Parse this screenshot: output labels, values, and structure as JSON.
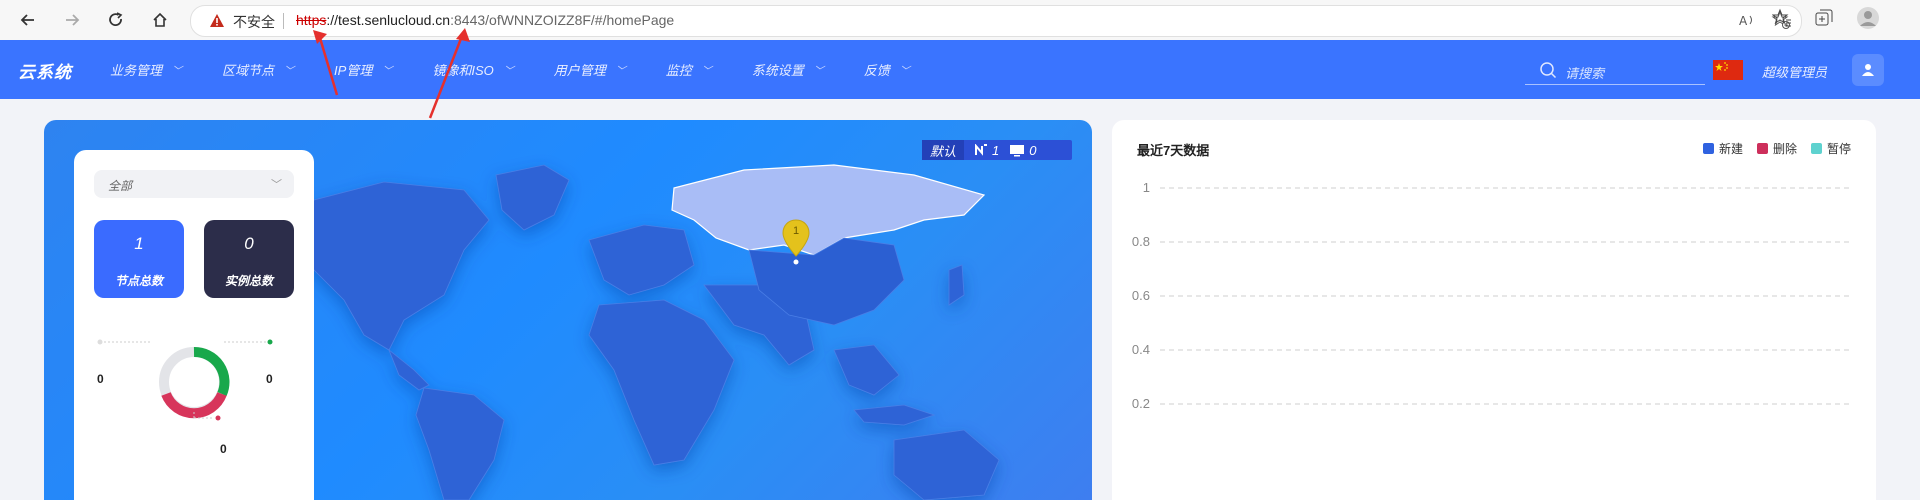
{
  "browser": {
    "insecure_label": "不安全",
    "url_scheme": "https",
    "url_host": "://test.senlucloud.cn",
    "url_rest": ":8443/ofWNNZOIZZ8F/#/homePage"
  },
  "app": {
    "logo": "云系统",
    "menu": [
      {
        "label": "业务管理"
      },
      {
        "label": "区域节点"
      },
      {
        "label": "IP管理"
      },
      {
        "label": "镜像和ISO"
      },
      {
        "label": "用户管理"
      },
      {
        "label": "监控"
      },
      {
        "label": "系统设置"
      },
      {
        "label": "反馈"
      }
    ],
    "search_placeholder": "请搜索",
    "admin_label": "超级管理员"
  },
  "map": {
    "badge_label": "默认",
    "count_a": "1",
    "count_b": "0",
    "pin_value": "1"
  },
  "stats": {
    "select_value": "全部",
    "node_total": "1",
    "node_total_label": "节点总数",
    "instance_total": "0",
    "instance_total_label": "实例总数",
    "donut_values": {
      "grey": "0",
      "green": "0",
      "red": "0"
    },
    "colors": {
      "blue": "#3a6bff",
      "dark": "#2c2d4a",
      "green": "#18a84b",
      "red": "#d7355b",
      "grey": "#e3e4e8"
    }
  },
  "chart": {
    "title": "最近7天数据",
    "legend": [
      {
        "name": "新建",
        "color": "#2f62e0"
      },
      {
        "name": "删除",
        "color": "#cd2f5b"
      },
      {
        "name": "暂停",
        "color": "#5ed2cf"
      }
    ]
  },
  "chart_data": {
    "type": "line",
    "title": "最近7天数据",
    "series": [
      {
        "name": "新建"
      },
      {
        "name": "删除"
      },
      {
        "name": "暂停"
      }
    ],
    "y_ticks": [
      "1",
      "0.8",
      "0.6",
      "0.4",
      "0.2"
    ],
    "ylim": [
      0,
      1
    ],
    "grid": true,
    "legend_position": "top-right"
  }
}
